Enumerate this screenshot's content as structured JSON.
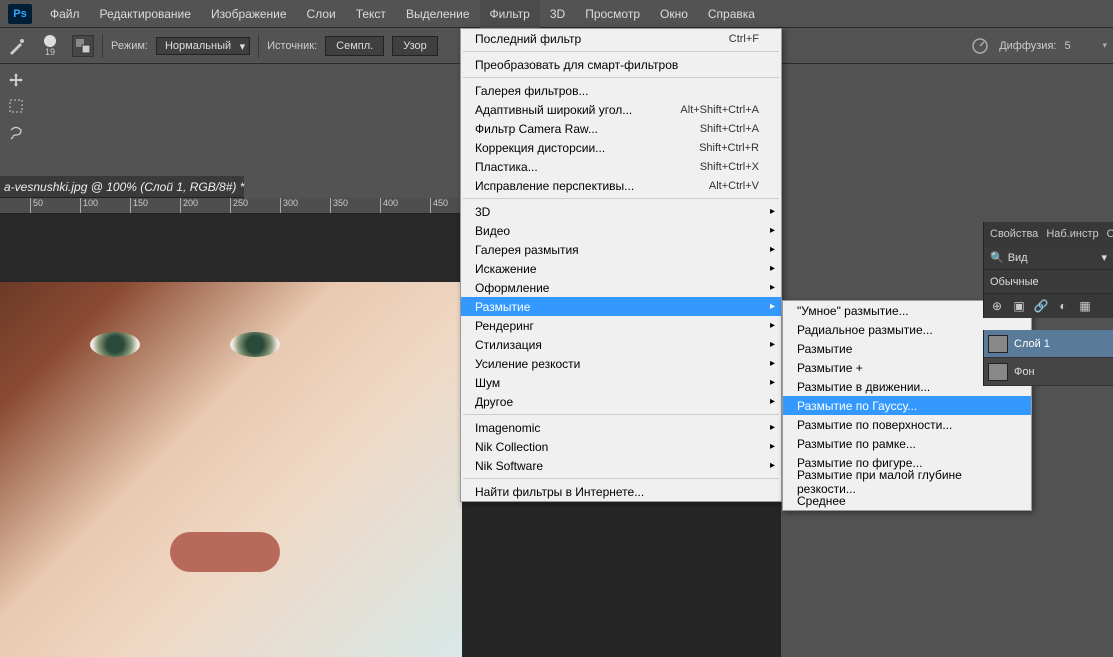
{
  "menubar": {
    "items": [
      "Файл",
      "Редактирование",
      "Изображение",
      "Слои",
      "Текст",
      "Выделение",
      "Фильтр",
      "3D",
      "Просмотр",
      "Окно",
      "Справка"
    ],
    "active_index": 6
  },
  "options": {
    "brush_size": "19",
    "mode_label": "Режим:",
    "mode_value": "Нормальный",
    "source_label": "Источник:",
    "source_value": "Семпл.",
    "pattern_label": "Узор",
    "diffusion_label": "Диффузия:",
    "diffusion_value": "5"
  },
  "doc_tab": "a-vesnushki.jpg @ 100% (Слой 1, RGB/8#) *",
  "ruler_ticks": [
    "50",
    "100",
    "150",
    "200",
    "250",
    "300",
    "350",
    "400",
    "450"
  ],
  "filter_menu": {
    "items": [
      {
        "label": "Последний фильтр",
        "shortcut": "Ctrl+F"
      },
      {
        "sep": true
      },
      {
        "label": "Преобразовать для смарт-фильтров"
      },
      {
        "sep": true
      },
      {
        "label": "Галерея фильтров..."
      },
      {
        "label": "Адаптивный широкий угол...",
        "shortcut": "Alt+Shift+Ctrl+A"
      },
      {
        "label": "Фильтр Camera Raw...",
        "shortcut": "Shift+Ctrl+A"
      },
      {
        "label": "Коррекция дисторсии...",
        "shortcut": "Shift+Ctrl+R"
      },
      {
        "label": "Пластика...",
        "shortcut": "Shift+Ctrl+X"
      },
      {
        "label": "Исправление перспективы...",
        "shortcut": "Alt+Ctrl+V"
      },
      {
        "sep": true
      },
      {
        "label": "3D",
        "sub": true
      },
      {
        "label": "Видео",
        "sub": true
      },
      {
        "label": "Галерея размытия",
        "sub": true
      },
      {
        "label": "Искажение",
        "sub": true
      },
      {
        "label": "Оформление",
        "sub": true
      },
      {
        "label": "Размытие",
        "sub": true,
        "highlight": true
      },
      {
        "label": "Рендеринг",
        "sub": true
      },
      {
        "label": "Стилизация",
        "sub": true
      },
      {
        "label": "Усиление резкости",
        "sub": true
      },
      {
        "label": "Шум",
        "sub": true
      },
      {
        "label": "Другое",
        "sub": true
      },
      {
        "sep": true
      },
      {
        "label": "Imagenomic",
        "sub": true
      },
      {
        "label": "Nik Collection",
        "sub": true
      },
      {
        "label": "Nik Software",
        "sub": true
      },
      {
        "sep": true
      },
      {
        "label": "Найти фильтры в Интернете..."
      }
    ]
  },
  "blur_submenu": {
    "items": [
      {
        "label": "\"Умное\" размытие..."
      },
      {
        "label": "Радиальное размытие..."
      },
      {
        "label": "Размытие"
      },
      {
        "label": "Размытие +"
      },
      {
        "label": "Размытие в движении..."
      },
      {
        "label": "Размытие по Гауссу...",
        "highlight": true
      },
      {
        "label": "Размытие по поверхности..."
      },
      {
        "label": "Размытие по рамке..."
      },
      {
        "label": "Размытие по фигуре..."
      },
      {
        "label": "Размытие при малой глубине резкости..."
      },
      {
        "label": "Среднее"
      }
    ]
  },
  "panels": {
    "props_tabs": [
      "Свойства",
      "Наб.инстр",
      "О"
    ],
    "search_icon": "🔍",
    "view_label": "Вид",
    "blend_label": "Обычные",
    "layers": [
      {
        "name": "Слой 1",
        "selected": true
      },
      {
        "name": "Фон",
        "selected": false
      }
    ]
  }
}
